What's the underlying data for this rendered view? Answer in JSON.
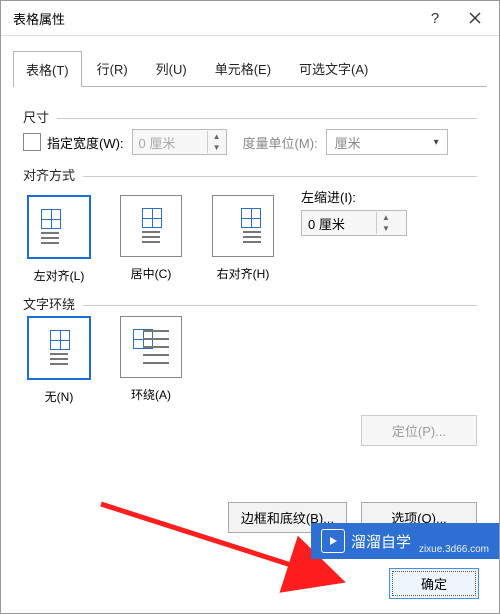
{
  "window": {
    "title": "表格属性"
  },
  "tabs": {
    "table": "表格(T)",
    "row": "行(R)",
    "column": "列(U)",
    "cell": "单元格(E)",
    "alttext": "可选文字(A)"
  },
  "size": {
    "section": "尺寸",
    "pref_width_label": "指定宽度(W):",
    "pref_width_value": "0 厘米",
    "unit_label": "度量单位(M):",
    "unit_value": "厘米"
  },
  "align": {
    "section": "对齐方式",
    "left": "左对齐(L)",
    "center": "居中(C)",
    "right": "右对齐(H)",
    "indent_label": "左缩进(I):",
    "indent_value": "0 厘米"
  },
  "wrap": {
    "section": "文字环绕",
    "none": "无(N)",
    "around": "环绕(A)"
  },
  "buttons": {
    "position": "定位(P)...",
    "borders": "边框和底纹(B)...",
    "options": "选项(O)...",
    "ok": "确定"
  },
  "watermark": {
    "brand": "溜溜自学",
    "url": "zixue.3d66.com"
  }
}
